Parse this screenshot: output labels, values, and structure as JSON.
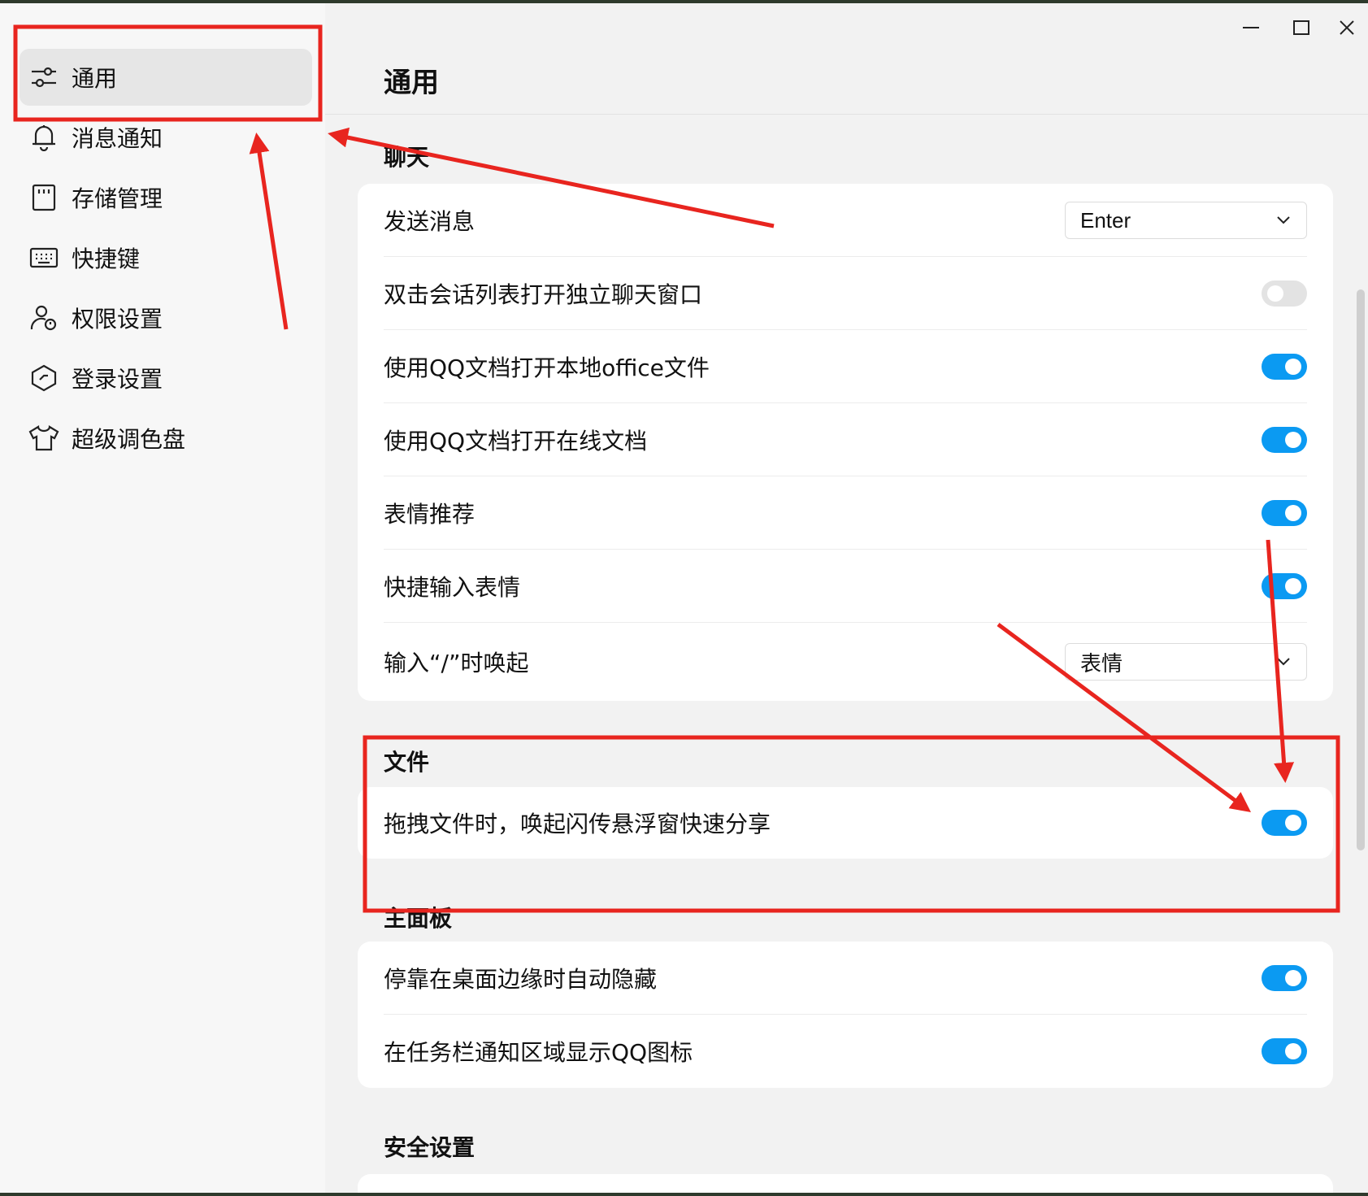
{
  "sidebar": {
    "items": [
      {
        "label": "通用",
        "icon": "sliders-icon",
        "active": true
      },
      {
        "label": "消息通知",
        "icon": "bell-icon"
      },
      {
        "label": "存储管理",
        "icon": "sd-card-icon"
      },
      {
        "label": "快捷键",
        "icon": "keyboard-icon"
      },
      {
        "label": "权限设置",
        "icon": "user-shield-icon"
      },
      {
        "label": "登录设置",
        "icon": "hexagon-check-icon"
      },
      {
        "label": "超级调色盘",
        "icon": "tshirt-icon"
      }
    ]
  },
  "window_controls": {
    "minimize": "minimize-icon",
    "maximize": "maximize-icon",
    "close": "close-icon"
  },
  "main": {
    "title": "通用",
    "sections": {
      "chat": {
        "title": "聊天",
        "rows": [
          {
            "label": "发送消息",
            "control": "select",
            "value": "Enter"
          },
          {
            "label": "双击会话列表打开独立聊天窗口",
            "control": "toggle",
            "on": false
          },
          {
            "label": "使用QQ文档打开本地office文件",
            "control": "toggle",
            "on": true
          },
          {
            "label": "使用QQ文档打开在线文档",
            "control": "toggle",
            "on": true
          },
          {
            "label": "表情推荐",
            "control": "toggle",
            "on": true
          },
          {
            "label": "快捷输入表情",
            "control": "toggle",
            "on": true
          },
          {
            "label": "输入“/”时唤起",
            "control": "select",
            "value": "表情"
          }
        ]
      },
      "file": {
        "title": "文件",
        "rows": [
          {
            "label": "拖拽文件时，唤起闪传悬浮窗快速分享",
            "control": "toggle",
            "on": true
          }
        ]
      },
      "panel": {
        "title": "主面板",
        "rows": [
          {
            "label": "停靠在桌面边缘时自动隐藏",
            "control": "toggle",
            "on": true
          },
          {
            "label": "在任务栏通知区域显示QQ图标",
            "control": "toggle",
            "on": true
          }
        ]
      },
      "security": {
        "title": "安全设置"
      }
    }
  },
  "colors": {
    "accent": "#0b9af2",
    "annotation": "#e8251f",
    "toggle_off": "#e3e3e3"
  }
}
